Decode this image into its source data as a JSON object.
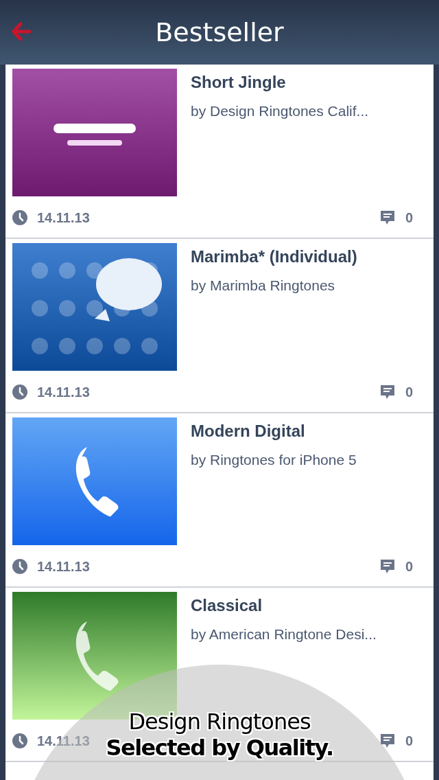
{
  "header": {
    "title": "Bestseller"
  },
  "items": [
    {
      "title": "Short Jingle",
      "artist": "by Design Ringtones Calif...",
      "date": "14.11.13",
      "comments": "0"
    },
    {
      "title": "Marimba* (Individual)",
      "artist": "by Marimba Ringtones",
      "date": "14.11.13",
      "comments": "0"
    },
    {
      "title": "Modern Digital",
      "artist": "by Ringtones for iPhone 5",
      "date": "14.11.13",
      "comments": "0"
    },
    {
      "title": "Classical",
      "artist": "by American Ringtone Desi...",
      "date": "14.11.13",
      "comments": "0"
    }
  ],
  "promo": {
    "line_1": "Design Ringtones",
    "line_2": "Selected by Quality."
  }
}
